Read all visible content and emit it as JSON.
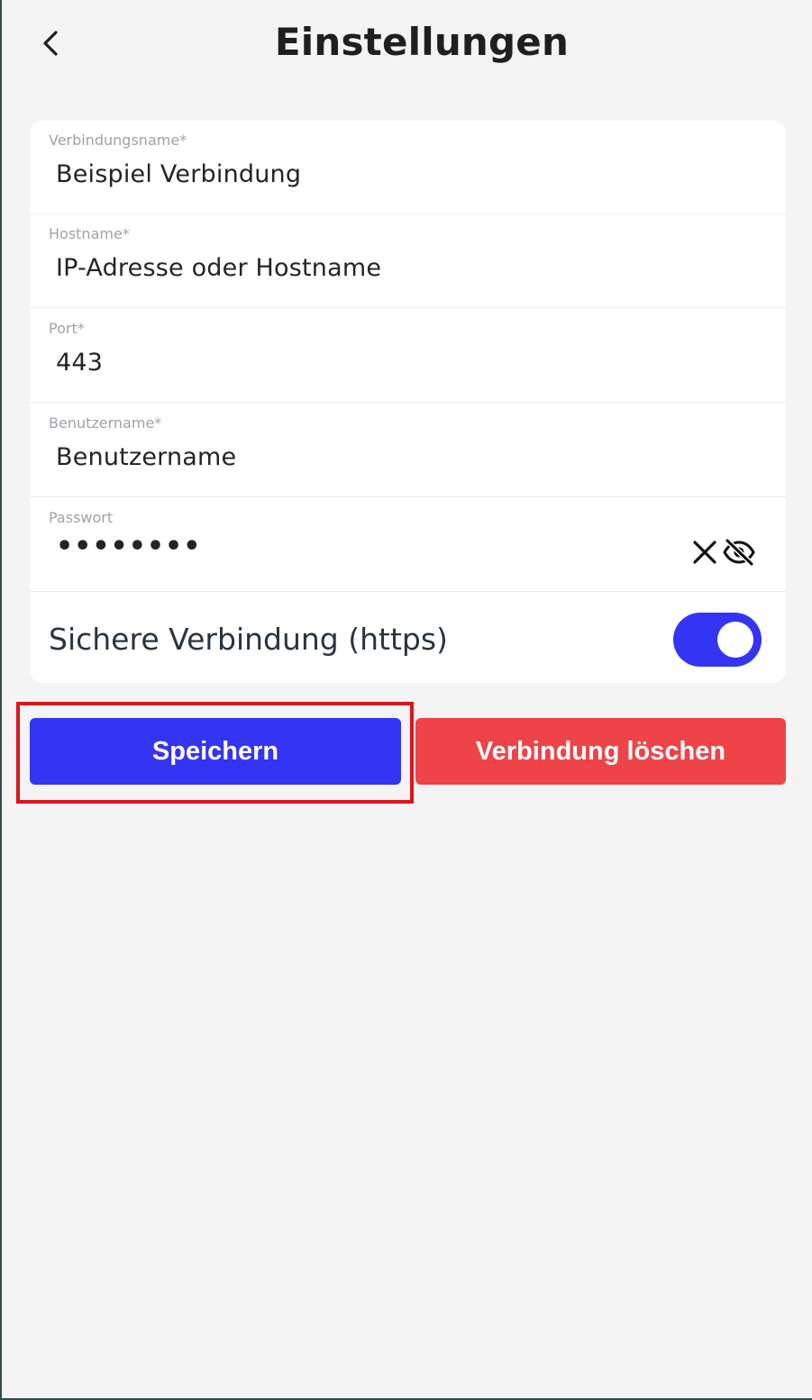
{
  "header": {
    "title": "Einstellungen"
  },
  "fields": [
    {
      "label": "Verbindungsname*",
      "value": "Beispiel Verbindung"
    },
    {
      "label": "Hostname*",
      "value": "IP-Adresse oder Hostname"
    },
    {
      "label": "Port*",
      "value": "443"
    },
    {
      "label": "Benutzername*",
      "value": "Benutzername"
    },
    {
      "label": "Passwort",
      "value": "••••••••"
    }
  ],
  "password_icons": {
    "clear": "close-icon",
    "visibility": "eye-off-icon"
  },
  "secure_connection": {
    "label": "Sichere Verbindung (https)",
    "enabled": true
  },
  "buttons": {
    "save_label": "Speichern",
    "delete_label": "Verbindung löschen"
  },
  "colors": {
    "accent": "#3434f5",
    "danger": "#ee4448",
    "highlight": "#e0141c",
    "background": "#f4f4f4"
  }
}
